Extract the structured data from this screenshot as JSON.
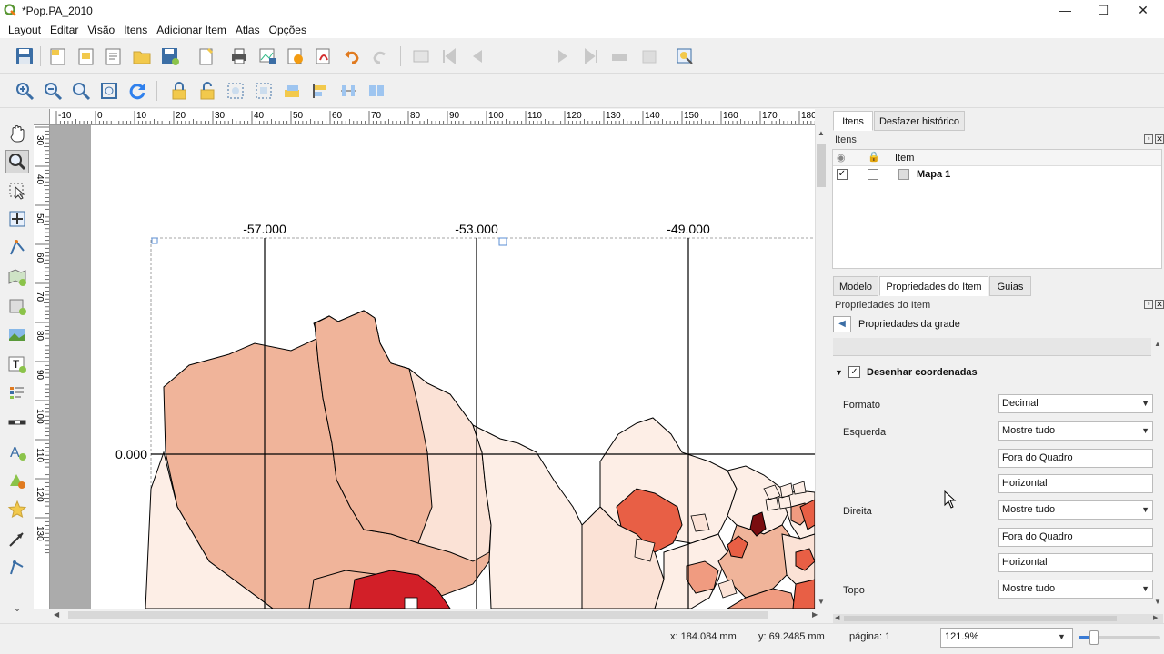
{
  "window": {
    "title": "*Pop.PA_2010",
    "minimize": "—",
    "maximize": "☐",
    "close": "✕"
  },
  "menu": [
    "Layout",
    "Editar",
    "Visão",
    "Itens",
    "Adicionar Item",
    "Atlas",
    "Opções"
  ],
  "toolbar": {
    "page_number": "1"
  },
  "rulers": {
    "horizontal": [
      "-10",
      "0",
      "10",
      "20",
      "30",
      "40",
      "50",
      "60",
      "70",
      "80",
      "90",
      "100",
      "110",
      "120",
      "130",
      "140",
      "150",
      "160",
      "170",
      "180"
    ],
    "vertical": [
      "30",
      "40",
      "50",
      "60",
      "70",
      "80",
      "90",
      "100",
      "110",
      "120",
      "130"
    ]
  },
  "map": {
    "grid_labels_top": [
      "-57.000",
      "-53.000",
      "-49.000"
    ],
    "grid_label_left": "0.000",
    "colors": {
      "light": "#fdeee6",
      "pale": "#fbe2d6",
      "mid": "#f0b49a",
      "salmon": "#f09b80",
      "orange": "#e85f45",
      "red": "#d21f28",
      "dark": "#7a0d10"
    }
  },
  "right_panel": {
    "tabs_top": [
      "Itens",
      "Desfazer histórico"
    ],
    "items_title": "Itens",
    "items_header": "Item",
    "items": [
      {
        "name": "Mapa 1",
        "visible": "✓"
      }
    ],
    "tabs_bottom": [
      "Modelo",
      "Propriedades do Item",
      "Guias"
    ],
    "props_title": "Propriedades do Item",
    "grid_props_label": "Propriedades da grade",
    "draw_coords": {
      "check": "✓",
      "label": "Desenhar coordenadas"
    },
    "fields": {
      "formato": {
        "label": "Formato",
        "value": "Decimal"
      },
      "esquerda": {
        "label": "Esquerda",
        "value": "Mostre tudo",
        "pos": "Fora do Quadro",
        "dir": "Horizontal"
      },
      "direita": {
        "label": "Direita",
        "value": "Mostre tudo",
        "pos": "Fora do Quadro",
        "dir": "Horizontal"
      },
      "topo": {
        "label": "Topo",
        "value": "Mostre tudo"
      }
    }
  },
  "status": {
    "x": "x: 184.084 mm",
    "y": "y: 69.2485 mm",
    "page": "página: 1",
    "zoom": "121.9%"
  }
}
